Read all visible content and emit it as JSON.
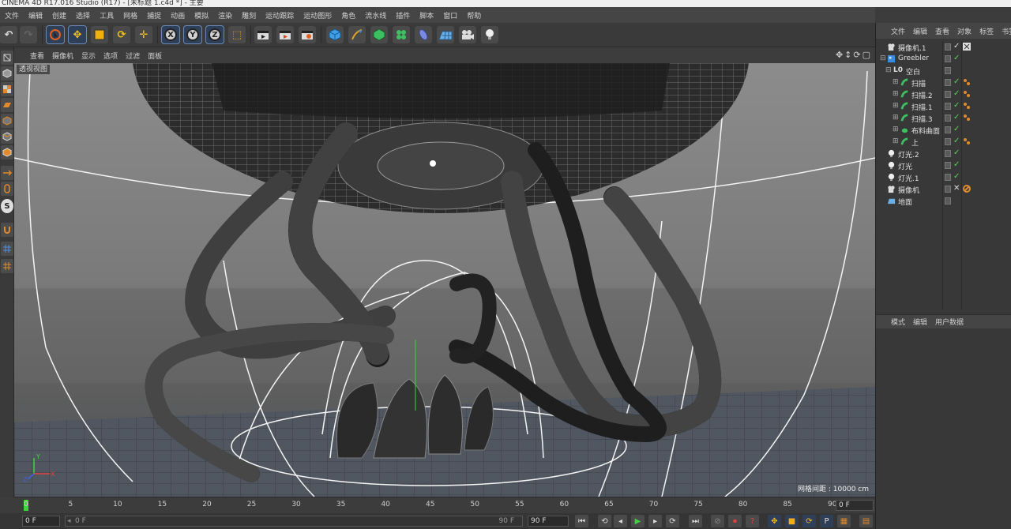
{
  "window": {
    "title": "CINEMA 4D R17.016 Studio (R17) - [未标题 1.c4d *] - 主要"
  },
  "menubar": [
    "文件",
    "编辑",
    "创建",
    "选择",
    "工具",
    "网格",
    "捕捉",
    "动画",
    "模拟",
    "渲染",
    "雕刻",
    "运动跟踪",
    "运动图形",
    "角色",
    "流水线",
    "插件",
    "脚本",
    "窗口",
    "帮助"
  ],
  "toolbar": {
    "axis_x": "X",
    "axis_y": "Y",
    "axis_z": "Z"
  },
  "viewport_menu": [
    "查看",
    "摄像机",
    "显示",
    "选项",
    "过滤",
    "面板"
  ],
  "viewport": {
    "label": "透视视图",
    "grid_spacing": "网格间距 : 10000 cm",
    "nav_icons": "✥↕⟳▢"
  },
  "left_tools": {
    "snap_label": "S"
  },
  "timeline": {
    "ticks": [
      "0",
      "5",
      "10",
      "15",
      "20",
      "25",
      "30",
      "35",
      "40",
      "45",
      "50",
      "55",
      "60",
      "65",
      "70",
      "75",
      "80",
      "85",
      "90"
    ],
    "current_frame": "0 F"
  },
  "transport": {
    "start_frame": "0 F",
    "range_start": "0 F",
    "range_end": "90 F",
    "end_frame": "90 F",
    "record_p_label": "P"
  },
  "object_manager": {
    "menu": [
      "文件",
      "编辑",
      "查看",
      "对象",
      "标签",
      "书签"
    ],
    "objects": [
      {
        "name": "摄像机.1",
        "type": "camera"
      },
      {
        "name": "Greebler",
        "type": "plugin"
      },
      {
        "name": "空白",
        "type": "null"
      },
      {
        "name": "扫描",
        "type": "sweep"
      },
      {
        "name": "扫描.2",
        "type": "sweep"
      },
      {
        "name": "扫描.1",
        "type": "sweep"
      },
      {
        "name": "扫描.3",
        "type": "sweep"
      },
      {
        "name": "布料曲面",
        "type": "cloth"
      },
      {
        "name": "上",
        "type": "sweep"
      },
      {
        "name": "灯光.2",
        "type": "light"
      },
      {
        "name": "灯光",
        "type": "light"
      },
      {
        "name": "灯光.1",
        "type": "light"
      },
      {
        "name": "摄像机",
        "type": "camera"
      },
      {
        "name": "地面",
        "type": "floor"
      }
    ]
  },
  "attributes": {
    "menu": [
      "模式",
      "编辑",
      "用户数据"
    ]
  },
  "colors": {
    "accent": "#6a8ab5",
    "check": "#5bd35b",
    "tag_orange": "#e08a2a",
    "axis_y": "#3fd13f",
    "axis_x": "#e04040",
    "axis_z": "#4060e0"
  }
}
